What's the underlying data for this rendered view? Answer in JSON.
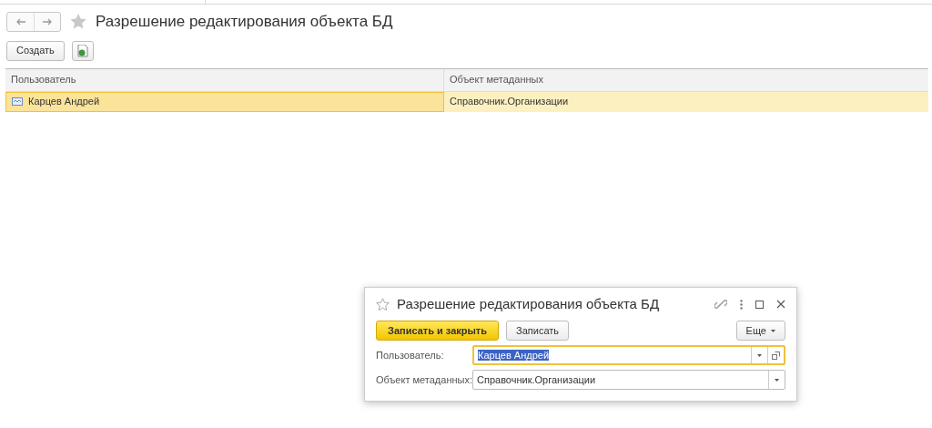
{
  "title": "Разрешение редактирования объекта БД",
  "toolbar": {
    "create_button": "Создать"
  },
  "table": {
    "columns": [
      "Пользователь",
      "Объект метаданных"
    ],
    "rows": [
      {
        "cells": [
          "Карцев Андрей",
          "Справочник.Организации"
        ],
        "selected": true
      }
    ]
  },
  "dialog": {
    "title": "Разрешение редактирования объекта БД",
    "buttons": [
      {
        "label": "Записать и закрыть",
        "kind": "primary"
      },
      {
        "label": "Записать",
        "kind": "secondary"
      }
    ],
    "more_button": "Еще",
    "fields": [
      {
        "label": "Пользователь:",
        "value": "Карцев Андрей",
        "focused": true,
        "value_selected": true,
        "open_button": true
      },
      {
        "label": "Объект метаданных:",
        "value": "Справочник.Организации",
        "focused": false,
        "value_selected": false,
        "open_button": false
      }
    ]
  }
}
